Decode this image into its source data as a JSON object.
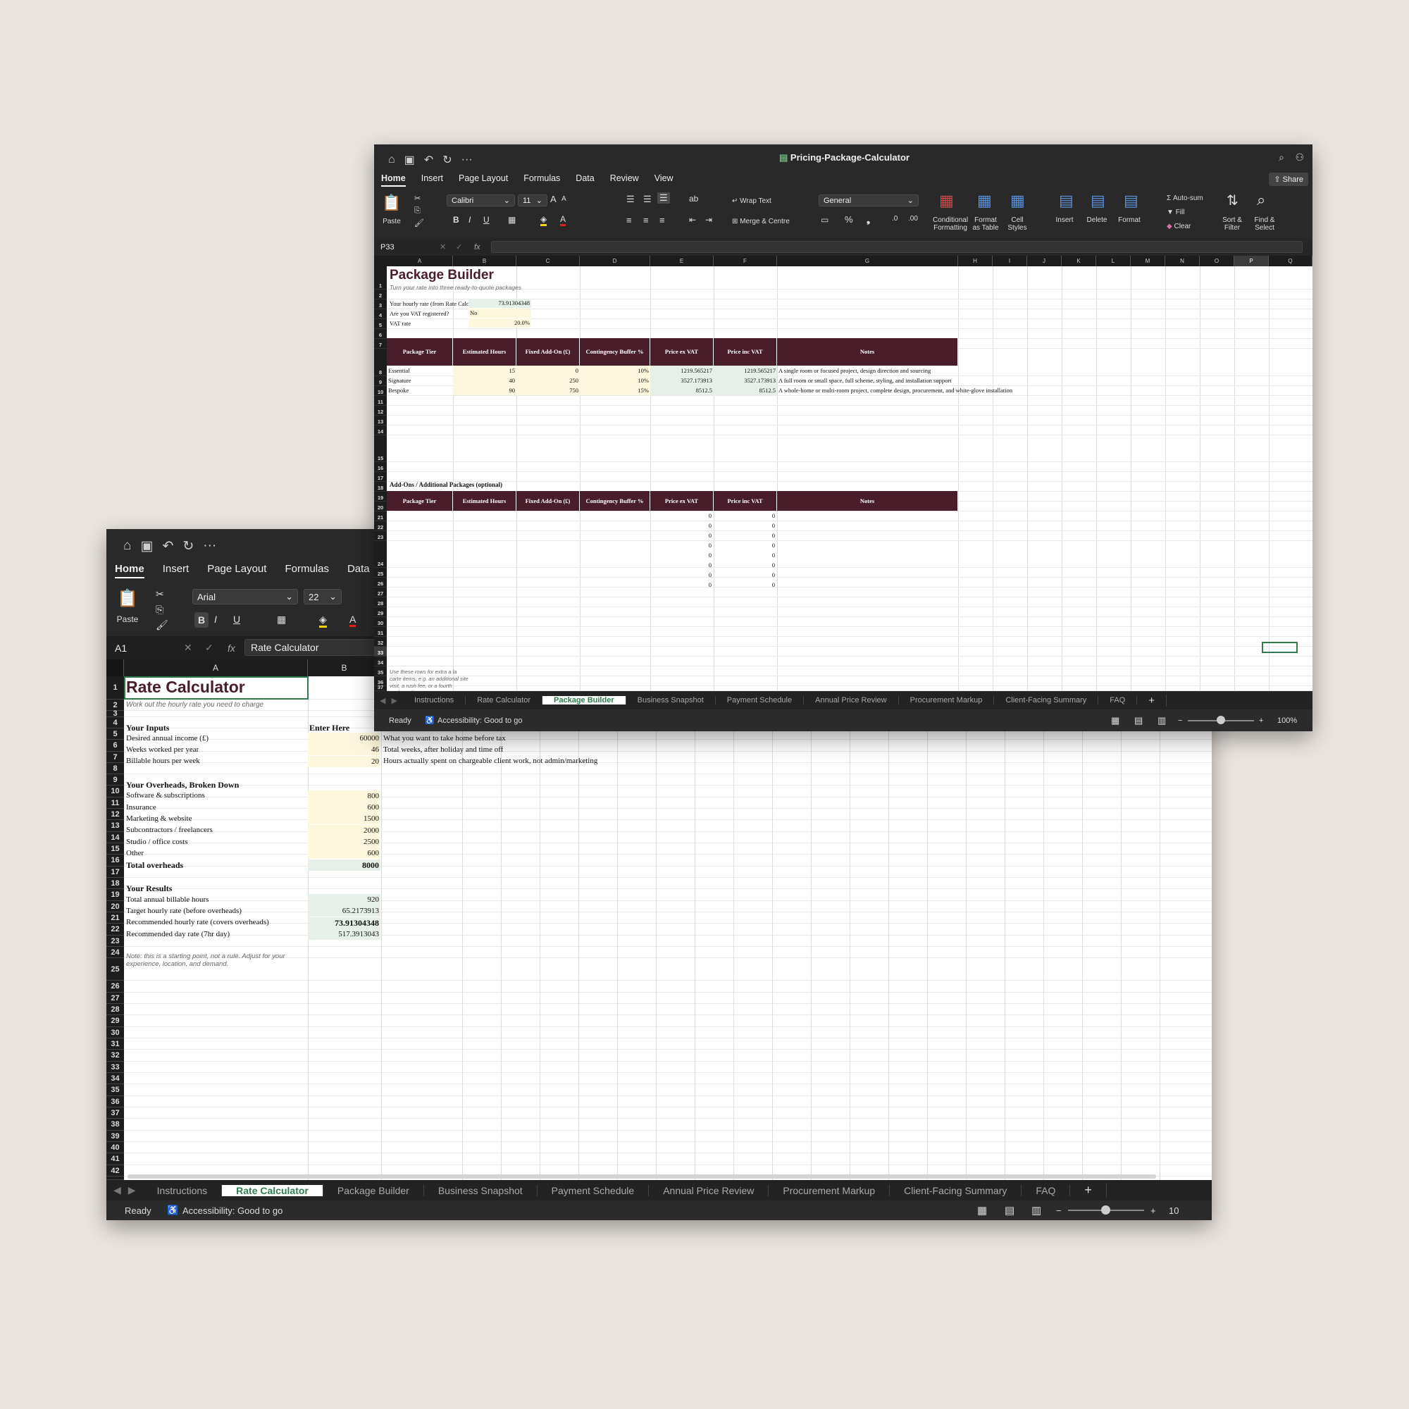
{
  "back": {
    "toolbar": {
      "home_icon": "⌂",
      "save_icon": "▣",
      "undo_icon": "↶",
      "redo_icon": "↻",
      "more_icon": "···"
    },
    "tabs": [
      "Home",
      "Insert",
      "Page Layout",
      "Formulas",
      "Data"
    ],
    "ribbon": {
      "paste": "Paste",
      "font": "Arial",
      "size": "22",
      "bold": "B",
      "italic": "I",
      "underline": "U"
    },
    "formula": {
      "name_box": "A1",
      "value": "Rate Calculator"
    },
    "col_headers": [
      "A",
      "B"
    ],
    "cells": {
      "title": "Rate Calculator",
      "subtitle": "Work out the hourly rate you need to charge",
      "inputs_h": "Your Inputs",
      "enter_here": "Enter Here",
      "r5a": "Desired annual income (£)",
      "r5b": "60000",
      "r5c": "What you want to take home before tax",
      "r6a": "Weeks worked per year",
      "r6b": "46",
      "r6c": "Total weeks, after holiday and time off",
      "r7a": "Billable hours per week",
      "r7b": "20",
      "r7c": "Hours actually spent on chargeable client work, not admin/marketing",
      "over_h": "Your Overheads, Broken Down",
      "r10a": "Software & subscriptions",
      "r10b": "800",
      "r11a": "Insurance",
      "r11b": "600",
      "r12a": "Marketing & website",
      "r12b": "1500",
      "r13a": "Subcontractors / freelancers",
      "r13b": "2000",
      "r14a": "Studio / office costs",
      "r14b": "2500",
      "r15a": "Other",
      "r15b": "600",
      "r16a": "Total overheads",
      "r16b": "8000",
      "res_h": "Your Results",
      "r19a": "Total annual billable hours",
      "r19b": "920",
      "r20a": "Target hourly rate (before overheads)",
      "r20b": "65.2173913",
      "r21a": "Recommended hourly rate (covers overheads)",
      "r21b": "73.91304348",
      "r22a": "Recommended day rate (7hr day)",
      "r22b": "517.3913043",
      "note": "Note: this is a starting point, not a rule. Adjust for your experience, location, and demand."
    },
    "sheet_tabs": [
      "Instructions",
      "Rate Calculator",
      "Package Builder",
      "Business Snapshot",
      "Payment Schedule",
      "Annual Price Review",
      "Procurement Markup",
      "Client-Facing Summary",
      "FAQ"
    ],
    "status": {
      "ready": "Ready",
      "access": "Accessibility: Good to go",
      "zoom": "10"
    }
  },
  "front": {
    "title": "Pricing-Package-Calculator",
    "share": "Share",
    "tabs": [
      "Home",
      "Insert",
      "Page Layout",
      "Formulas",
      "Data",
      "Review",
      "View"
    ],
    "ribbon": {
      "paste": "Paste",
      "font": "Calibri",
      "size": "11",
      "wrap": "Wrap Text",
      "merge": "Merge & Centre",
      "numfmt": "General",
      "cond": "Conditional Formatting",
      "fmt_table": "Format as Table",
      "cell_styles": "Cell Styles",
      "insert": "Insert",
      "delete": "Delete",
      "format": "Format",
      "autosum": "Auto-sum",
      "fill": "Fill",
      "clear": "Clear",
      "sort": "Sort & Filter",
      "find": "Find & Select",
      "bold": "B",
      "italic": "I",
      "underline": "U"
    },
    "formula": {
      "name_box": "P33",
      "value": ""
    },
    "col_headers": [
      "A",
      "B",
      "C",
      "D",
      "E",
      "F",
      "G",
      "H",
      "I",
      "J",
      "K",
      "L",
      "M",
      "N",
      "O",
      "P",
      "Q"
    ],
    "cells": {
      "title": "Package Builder",
      "subtitle": "Turn your rate into three ready-to-quote packages",
      "r4a": "Your hourly rate (from Rate Calcul",
      "r4b": "73.91304348",
      "r5a": "Are you VAT registered?",
      "r5b": "No",
      "r6a": "VAT rate",
      "r6b": "20.0%",
      "h_tier": "Package Tier",
      "h_hours": "Estimated Hours",
      "h_fixed": "Fixed Add-On (£)",
      "h_cont": "Contingency Buffer %",
      "h_ex": "Price ex VAT",
      "h_inc": "Price inc VAT",
      "h_notes": "Notes",
      "rows": [
        {
          "tier": "Essential",
          "hours": "15",
          "fixed": "0",
          "cont": "10%",
          "ex": "1219.565217",
          "inc": "1219.565217",
          "notes": "A single room or focused project, design direction and sourcing"
        },
        {
          "tier": "Signature",
          "hours": "40",
          "fixed": "250",
          "cont": "10%",
          "ex": "3527.173913",
          "inc": "3527.173913",
          "notes": "A full room or small space, full scheme, styling, and installation support"
        },
        {
          "tier": "Bespoke",
          "hours": "90",
          "fixed": "750",
          "cont": "15%",
          "ex": "8512.5",
          "inc": "8512.5",
          "notes": "A whole-home or multi-room project, complete design, procurement, and white-glove installation"
        }
      ],
      "addons_h": "Add-Ons / Additional Packages (optional)",
      "zero": "0",
      "note": "Use these rows for extra a la carte items, e.g. an additional site visit, a rush fee, or a fourth package tier."
    },
    "sheet_tabs": [
      "Instructions",
      "Rate Calculator",
      "Package Builder",
      "Business Snapshot",
      "Payment Schedule",
      "Annual Price Review",
      "Procurement Markup",
      "Client-Facing Summary",
      "FAQ"
    ],
    "status": {
      "ready": "Ready",
      "access": "Accessibility: Good to go",
      "zoom": "100%"
    }
  }
}
